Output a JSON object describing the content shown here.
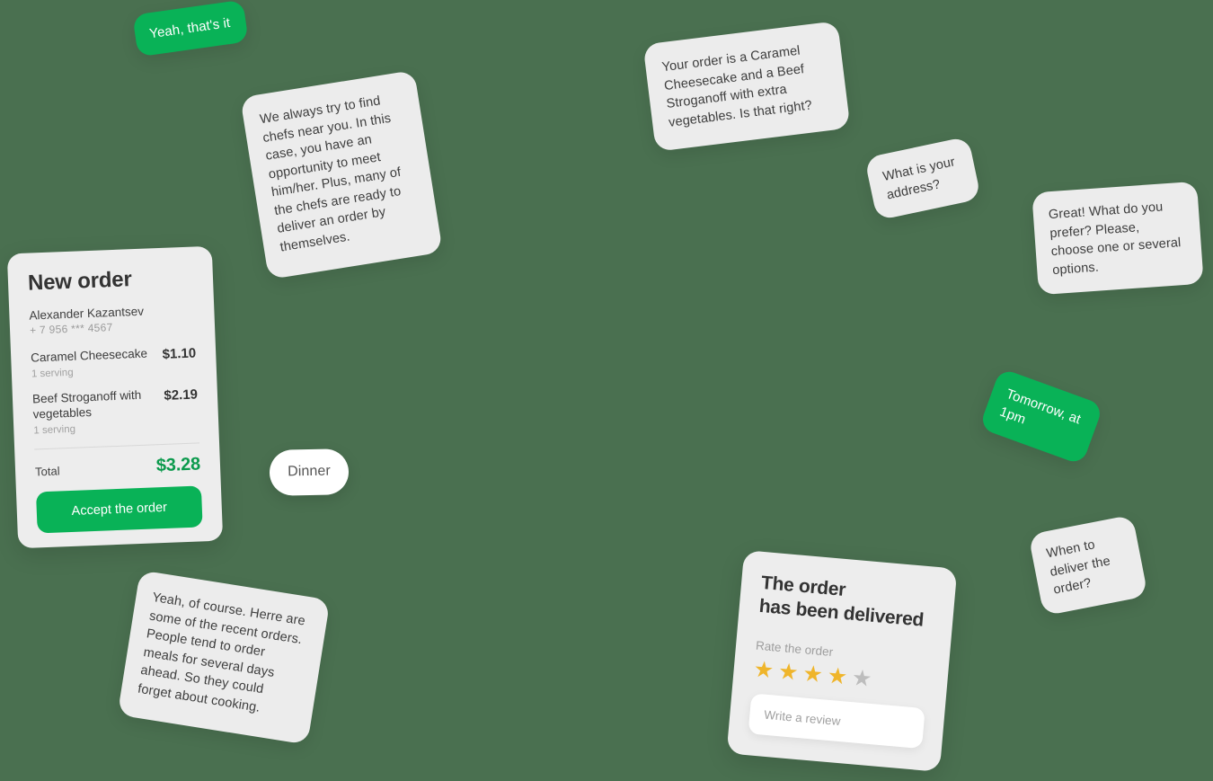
{
  "canvas": {
    "background_color": "#4a7050",
    "accent_green": "#09b257",
    "total_green": "#0c9a4d",
    "bubble_grey": "#ececec",
    "star_gold": "#efb52b",
    "star_grey": "#bdbdbd"
  },
  "bubbles": {
    "yeah_thats_it": "Yeah, that's it",
    "chefs_near": "We always try to find chefs near you. In this case, you have an opportunity to meet him/her. Plus, many of the chefs are ready to deliver an order by themselves.",
    "order_confirm": "Your order is a Caramel Cheesecake and a Beef Stroganoff with extra vegetables. Is that right?",
    "address": "What is your address?",
    "prefer": "Great! What do you prefer? Please, choose one or several options.",
    "tomorrow": "Tomorrow, at 1pm",
    "when_deliver": "When to deliver the order?",
    "dinner": "Dinner",
    "recent_orders": "Yeah, of course. Herre are some of the recent orders. People tend to order meals for several days ahead. So they could forget about cooking."
  },
  "order_card": {
    "title": "New order",
    "customer_name": "Alexander Kazantsev",
    "customer_phone": "+ 7 956 *** 4567",
    "items": [
      {
        "name": "Caramel Cheesecake",
        "serving": "1 serving",
        "price": "$1.10"
      },
      {
        "name": "Beef Stroganoff with vegetables",
        "serving": "1 serving",
        "price": "$2.19"
      }
    ],
    "total_label": "Total",
    "total_value": "$3.28",
    "accept_label": "Accept the order"
  },
  "delivered_card": {
    "title": "The order\nhas been delivered",
    "rate_label": "Rate the order",
    "rating": 4,
    "max_rating": 5,
    "stars": [
      "★",
      "★",
      "★",
      "★",
      "★"
    ],
    "review_placeholder": "Write a review"
  }
}
